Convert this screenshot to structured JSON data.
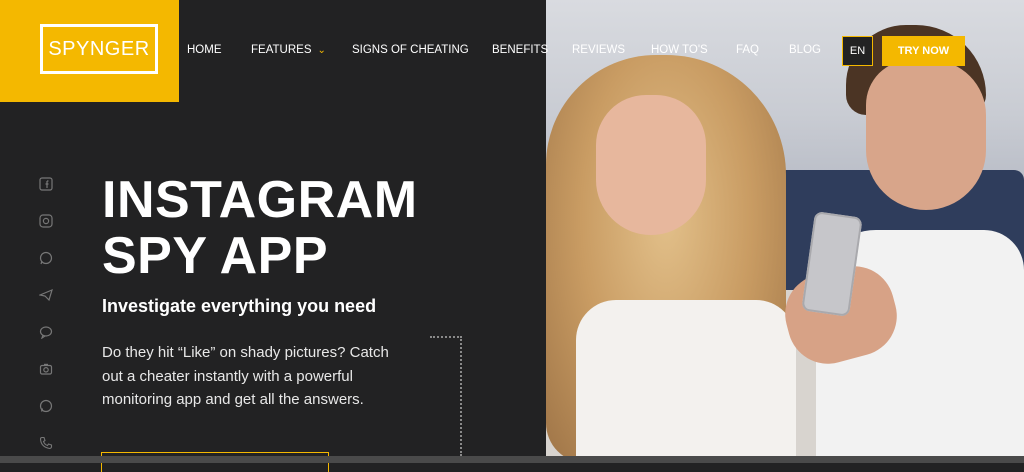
{
  "brand": {
    "logo_text": "SPYNGER",
    "accent": "#f4b800"
  },
  "nav": {
    "items": [
      {
        "label": "HOME"
      },
      {
        "label": "FEATURES"
      },
      {
        "label": "SIGNS OF CHEATING"
      },
      {
        "label": "BENEFITS"
      },
      {
        "label": "REVIEWS"
      },
      {
        "label": "HOW TO'S"
      },
      {
        "label": "FAQ"
      },
      {
        "label": "BLOG"
      }
    ],
    "language": "EN",
    "cta": "TRY NOW"
  },
  "social_icons": [
    "facebook-icon",
    "instagram-icon",
    "whatsapp-icon",
    "telegram-icon",
    "chat-icon",
    "camera-icon",
    "message-icon",
    "phone-icon"
  ],
  "hero": {
    "title_line1": "INSTAGRAM",
    "title_line2": "SPY APP",
    "subtitle": "Investigate everything you need",
    "description": "Do they hit “Like” on shady pictures? Catch out a cheater instantly with a powerful monitoring app and get all the answers."
  }
}
